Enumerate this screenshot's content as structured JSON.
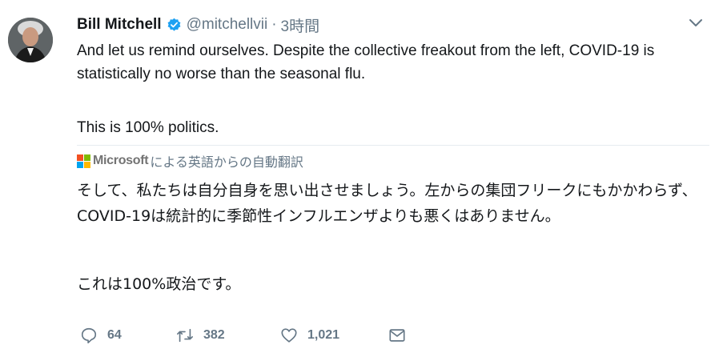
{
  "tweet": {
    "author_name": "Bill Mitchell",
    "handle": "@mitchellvii",
    "separator": "·",
    "time": "3時間",
    "text_para1": "And let us remind ourselves. Despite the collective freakout from the left, COVID-19 is statistically no worse than the seasonal flu.",
    "text_para2": "This is 100% politics.",
    "translation_brand": "Microsoft",
    "translation_label": "による英語からの自動翻訳",
    "translation_para1": "そして、私たちは自分自身を思い出させましょう。左からの集団フリークにもかかわらず、COVID-19は統計的に季節性インフルエンザよりも悪くはありません。",
    "translation_para2": "これは100%政治です。"
  },
  "actions": {
    "replies": "64",
    "retweets": "382",
    "likes": "1,021"
  },
  "colors": {
    "verified": "#1da1f2",
    "secondary_text": "#657786",
    "ms_red": "#f25022",
    "ms_green": "#7fba00",
    "ms_blue": "#00a4ef",
    "ms_yellow": "#ffb900"
  },
  "icons": [
    "verified-badge-icon",
    "chevron-down-icon",
    "reply-icon",
    "retweet-icon",
    "like-icon",
    "direct-message-icon"
  ]
}
